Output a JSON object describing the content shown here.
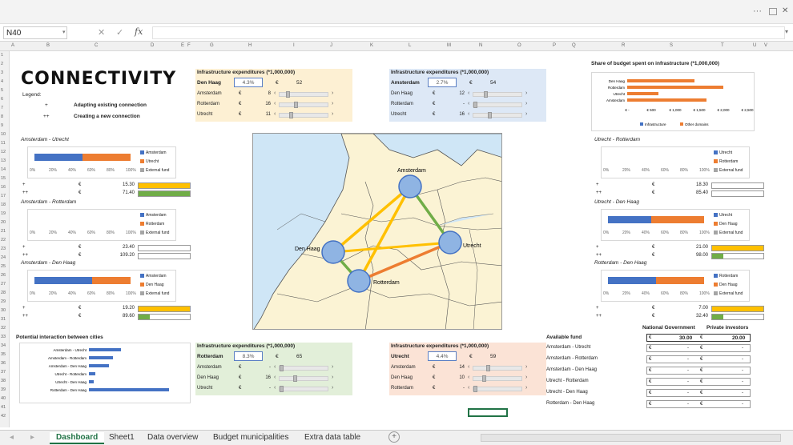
{
  "app": {
    "name_box": "N40",
    "fx": "fx",
    "window_ctrl": "···"
  },
  "colors": {
    "blue": "#4472c4",
    "orange": "#ed7d31",
    "yellow": "#ffc000",
    "green": "#70ad47",
    "panel_yellow": "#fdf0d3",
    "panel_blue": "#dde8f6",
    "panel_green": "#e2efd9",
    "panel_pink": "#fbe3d6"
  },
  "columns": [
    "A",
    "B",
    "C",
    "D",
    "E",
    "F",
    "G",
    "H",
    "I",
    "J",
    "K",
    "L",
    "M",
    "N",
    "O",
    "P",
    "Q",
    "R",
    "S",
    "T",
    "U",
    "V"
  ],
  "rows": [
    "1",
    "2",
    "3",
    "4",
    "5",
    "6",
    "7",
    "8",
    "9",
    "10",
    "11",
    "12",
    "13",
    "14",
    "15",
    "16",
    "17",
    "18",
    "19",
    "20",
    "21",
    "22",
    "23",
    "24",
    "25",
    "26",
    "27",
    "28",
    "29",
    "30",
    "31",
    "32",
    "33",
    "34",
    "35",
    "36",
    "37",
    "38",
    "39",
    "40",
    "41",
    "42"
  ],
  "logo": "CONNECTIVITY",
  "legend": {
    "title": "Legend:",
    "items": [
      {
        "sym": "+",
        "text": "Adapting existing connection"
      },
      {
        "sym": "++",
        "text": "Creating a new connection"
      }
    ]
  },
  "infra_panels": [
    {
      "title": "Infrastructure expenditures (*1,000,000)",
      "city": "Den Haag",
      "pct": "4.3%",
      "cur": "€",
      "val": "52",
      "rows": [
        {
          "name": "Amsterdam",
          "v": "8",
          "t": 0.15
        },
        {
          "name": "Rotterdam",
          "v": "16",
          "t": 0.32
        },
        {
          "name": "Utrecht",
          "v": "11",
          "t": 0.22
        }
      ]
    },
    {
      "title": "Infrastructure expenditures (*1,000,000)",
      "city": "Amsterdam",
      "pct": "2.7%",
      "cur": "€",
      "val": "54",
      "rows": [
        {
          "name": "Den Haag",
          "v": "12",
          "t": 0.24
        },
        {
          "name": "Rotterdam",
          "v": "-",
          "t": 0.0
        },
        {
          "name": "Utrecht",
          "v": "16",
          "t": 0.32
        }
      ]
    },
    {
      "title": "Infrastructure expenditures (*1,000,000)",
      "city": "Rotterdam",
      "pct": "8.3%",
      "cur": "€",
      "val": "65",
      "rows": [
        {
          "name": "Amsterdam",
          "v": "-",
          "t": 0.0
        },
        {
          "name": "Den Haag",
          "v": "16",
          "t": 0.3
        },
        {
          "name": "Utrecht",
          "v": "-",
          "t": 0.0
        }
      ]
    },
    {
      "title": "Infrastructure expenditures (*1,000,000)",
      "city": "Utrecht",
      "pct": "4.4%",
      "cur": "€",
      "val": "59",
      "rows": [
        {
          "name": "Amsterdam",
          "v": "14",
          "t": 0.28
        },
        {
          "name": "Den Haag",
          "v": "10",
          "t": 0.2
        },
        {
          "name": "Rotterdam",
          "v": "-",
          "t": 0.0
        }
      ]
    }
  ],
  "route_charts": [
    {
      "title": "Amsterdam - Utrecht",
      "seg": [
        0.5,
        0.5
      ],
      "legend": [
        "Amsterdam",
        "Utrecht",
        "External fund"
      ],
      "plus": "15.30",
      "plusplus": "71.40",
      "fill_plus": "yellow",
      "fill_pp": "green"
    },
    {
      "title": "Amsterdam - Rotterdam",
      "seg": [
        0,
        0
      ],
      "legend": [
        "Amsterdam",
        "Rotterdam",
        "External fund"
      ],
      "plus": "23.40",
      "plusplus": "109.20",
      "fill_plus": "",
      "fill_pp": ""
    },
    {
      "title": "Amsterdam - Den Haag",
      "seg": [
        0.6,
        0.4
      ],
      "legend": [
        "Amsterdam",
        "Den Haag",
        "External fund"
      ],
      "plus": "19.20",
      "plusplus": "89.60",
      "fill_plus": "yellow",
      "fill_pp": "green_short"
    },
    {
      "title": "Utrecht - Rotterdam",
      "seg": [
        0,
        0
      ],
      "legend": [
        "Utrecht",
        "Rotterdam",
        "External fund"
      ],
      "plus": "18.30",
      "plusplus": "85.40",
      "fill_plus": "",
      "fill_pp": ""
    },
    {
      "title": "Utrecht - Den Haag",
      "seg": [
        0.45,
        0.55
      ],
      "legend": [
        "Utrecht",
        "Den Haag",
        "External fund"
      ],
      "plus": "21.00",
      "plusplus": "98.00",
      "fill_plus": "yellow",
      "fill_pp": "green_short"
    },
    {
      "title": "Rotterdam - Den Haag",
      "seg": [
        0.5,
        0.5
      ],
      "legend": [
        "Rotterdam",
        "Den Haag",
        "External fund"
      ],
      "plus": "7.00",
      "plusplus": "32.40",
      "fill_plus": "yellow",
      "fill_pp": "green_short"
    }
  ],
  "axis_ticks": [
    "0%",
    "20%",
    "40%",
    "60%",
    "80%",
    "100%"
  ],
  "share_chart": {
    "title": "Share of budget spent on infrastructure (*1,000,000)",
    "type": "bar",
    "categories": [
      "Den Haag",
      "Rotterdam",
      "Utrecht",
      "Amsterdam"
    ],
    "series": [
      {
        "name": "Infrastructure",
        "values": [
          0,
          0,
          0,
          0
        ]
      },
      {
        "name": "Other domains",
        "values": [
          1400,
          2000,
          650,
          1650
        ]
      }
    ],
    "xticks": [
      "€ -",
      "€ 500",
      "€ 1,000",
      "€ 1,500",
      "€ 2,000",
      "€ 2,500"
    ],
    "xlim": [
      0,
      2500
    ]
  },
  "interaction_chart": {
    "title": "Potential interaction between cities",
    "type": "bar",
    "categories": [
      "Amsterdam - Utrecht",
      "Amsterdam - Rotterdam",
      "Amsterdam - Den Haag",
      "Utrecht - Rotterdam",
      "Utrecht - Den Haag",
      "Rotterdam - Den Haag"
    ],
    "values": [
      0.4,
      0.3,
      0.25,
      0.08,
      0.06,
      1.0
    ]
  },
  "map": {
    "cities": [
      {
        "name": "Amsterdam"
      },
      {
        "name": "Den Haag"
      },
      {
        "name": "Rotterdam"
      },
      {
        "name": "Utrecht"
      }
    ]
  },
  "funds": {
    "title": "Available fund",
    "headers": [
      "National Government",
      "Private investors"
    ],
    "top": [
      "€",
      "30.00",
      "€",
      "20.00"
    ],
    "rows": [
      "Amsterdam - Utrecht",
      "Amsterdam - Rotterdam",
      "Amsterdam - Den Haag",
      "Utrecht - Rotterdam",
      "Utrecht - Den Haag",
      "Rotterdam - Den Haag"
    ],
    "cur": "€",
    "dash": "-"
  },
  "tabs": [
    "Dashboard",
    "Sheet1",
    "Data overview",
    "Budget municipalities",
    "Extra data table"
  ],
  "symbols": {
    "plus": "+",
    "plusplus": "++",
    "euro": "€",
    "lt": "‹",
    "gt": "›",
    "add": "+"
  }
}
